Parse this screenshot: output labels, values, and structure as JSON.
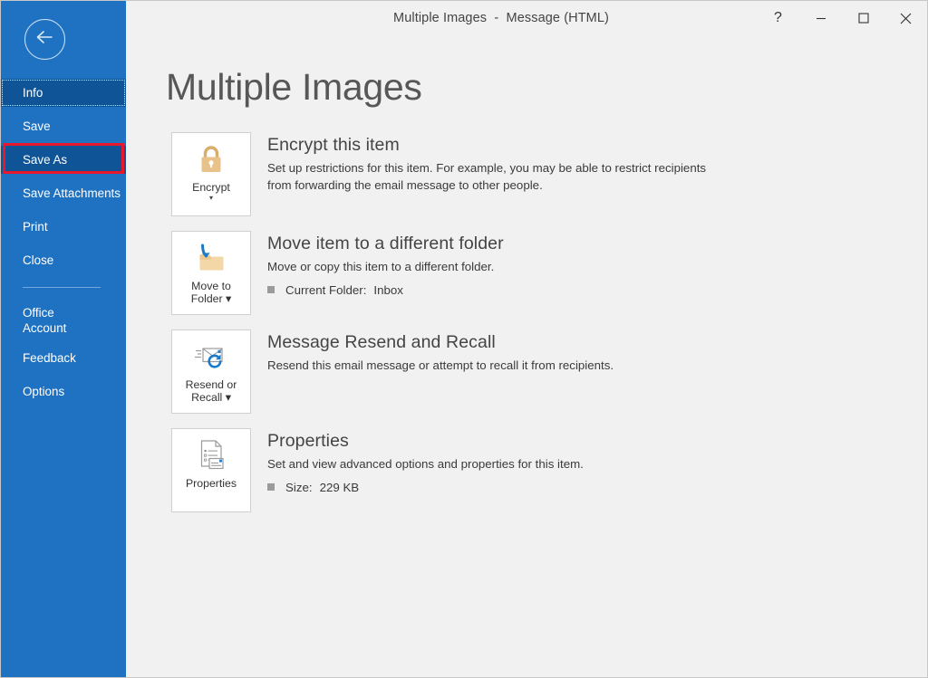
{
  "window": {
    "title": "Multiple Images  -  Message (HTML)",
    "accent_color": "#2272c4",
    "controls": {
      "help": "?",
      "minimize": "Minimize",
      "maximize": "Maximize",
      "close": "Close"
    }
  },
  "sidebar": {
    "background_color": "#1f72c2",
    "selected_color": "#0f5496",
    "back_label": "Back",
    "items": [
      {
        "label": "Info",
        "state": "selected"
      },
      {
        "label": "Save",
        "state": "normal"
      },
      {
        "label": "Save As",
        "state": "highlighted"
      },
      {
        "label": "Save Attachments",
        "state": "normal"
      },
      {
        "label": "Print",
        "state": "normal"
      },
      {
        "label": "Close",
        "state": "normal"
      },
      {
        "label": "Office\nAccount",
        "state": "normal"
      },
      {
        "label": "Feedback",
        "state": "normal"
      },
      {
        "label": "Options",
        "state": "normal"
      }
    ]
  },
  "annotation": {
    "target": "Save As",
    "color": "#e8172b"
  },
  "main": {
    "page_title": "Multiple Images",
    "sections": [
      {
        "tile_label": "Encrypt",
        "tile_icon": "padlock-icon",
        "has_caret": true,
        "caret_position": "below",
        "heading": "Encrypt this item",
        "description": "Set up restrictions for this item. For example, you may be able to restrict recipients from forwarding the email message to other people.",
        "facts": []
      },
      {
        "tile_label": "Move to\nFolder",
        "tile_icon": "move-to-folder-icon",
        "has_caret": true,
        "caret_position": "inline",
        "heading": "Move item to a different folder",
        "description": "Move or copy this item to a different folder.",
        "facts": [
          {
            "label": "Current Folder:",
            "value": "Inbox"
          }
        ]
      },
      {
        "tile_label": "Resend or\nRecall",
        "tile_icon": "resend-recall-icon",
        "has_caret": true,
        "caret_position": "inline",
        "heading": "Message Resend and Recall",
        "description": "Resend this email message or attempt to recall it from recipients.",
        "facts": []
      },
      {
        "tile_label": "Properties",
        "tile_icon": "properties-icon",
        "has_caret": false,
        "caret_position": "none",
        "heading": "Properties",
        "description": "Set and view advanced options and properties for this item.",
        "facts": [
          {
            "label": "Size:",
            "value": "229 KB"
          }
        ]
      }
    ]
  }
}
